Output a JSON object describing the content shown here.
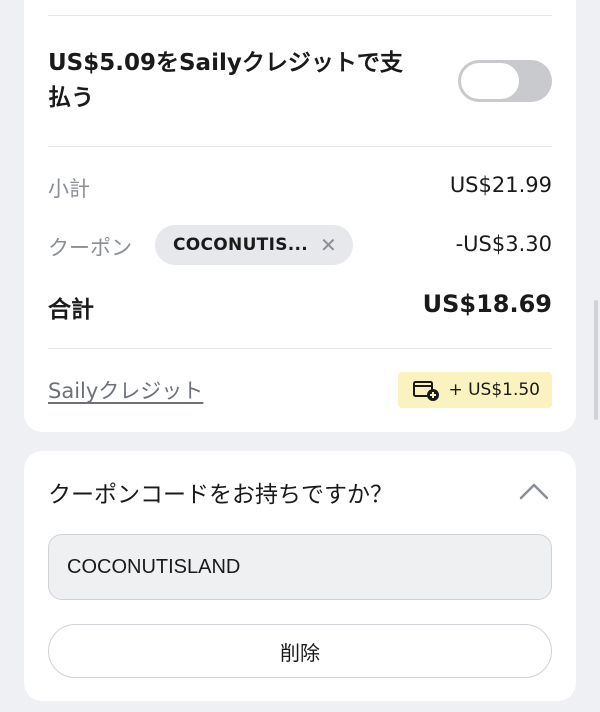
{
  "credit_pay": {
    "text": "US$5.09をSailyクレジットで支払う",
    "toggle_on": false
  },
  "summary": {
    "subtotal_label": "小計",
    "subtotal_value": "US$21.99",
    "coupon_label": "クーポン",
    "coupon_chip": "COCONUTIS...",
    "coupon_discount": "-US$3.30",
    "total_label": "合計",
    "total_value": "US$18.69"
  },
  "credit": {
    "link_label": "Sailyクレジット",
    "badge_text": "+ US$1.50",
    "badge_icon": "wallet-plus-icon"
  },
  "coupon_section": {
    "question": "クーポンコードをお持ちですか？",
    "input_value": "COCONUTISLAND",
    "remove_label": "削除"
  },
  "colors": {
    "badge_bg": "#fbf3bf",
    "toggle_off": "#c9cacd",
    "page_bg": "#eef0f3"
  }
}
